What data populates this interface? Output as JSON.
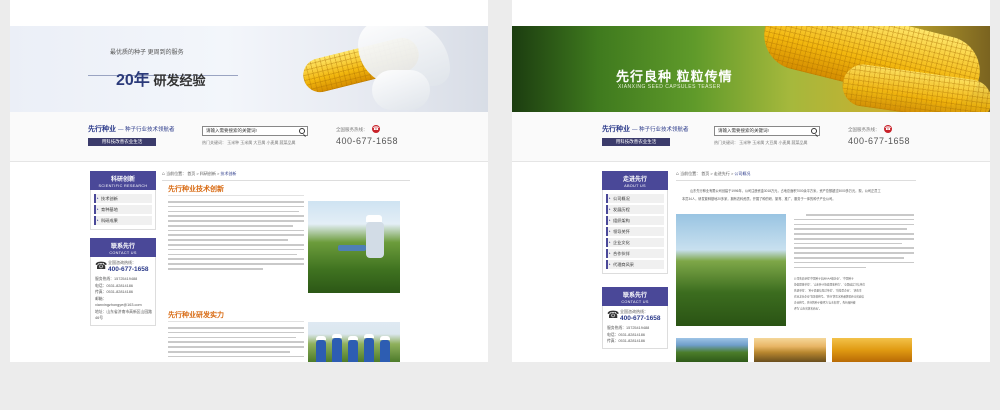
{
  "header": {
    "logo_brand": "先行种业",
    "logo_slogan": "— 种子行业技术领航者",
    "logo_tag": "用科技改善农业生活",
    "search_placeholder": "请输入需要搜索的关键词!",
    "hot_keywords": "热门关键词：  玉米种  玉米属  大豆属  小麦属  蔬菜品属",
    "hotline_label": "全国服务热线：",
    "hotline_number": "400-677-1658"
  },
  "left_page": {
    "banner": {
      "subtitle": "最优质的种子 更周到的服务",
      "years": "20年",
      "title": "研发经验"
    },
    "sidebar": {
      "title": "科研创新",
      "subtitle": "SCIENTIFIC RESEARCH",
      "items": [
        "技术创新",
        "育种基地",
        "科研成果"
      ]
    },
    "contact": {
      "title": "联系先行",
      "subtitle": "CONTACT US",
      "tel_label": "全国咨询热线：",
      "tel_number": "400-677-1658",
      "lines": [
        "服务热线：15725419488",
        "电话：0531-82814186",
        "传真：0531-82814186",
        "邮箱：",
        "xianxingzhongye@163.com",
        "地址：山东省济南市高新区山园路",
        "46号"
      ]
    },
    "breadcrumb": {
      "home": "当前位置：",
      "path": "首页  >  科研创新  >",
      "current": "技术创新"
    },
    "section1_title": "先行种业技术创新",
    "section2_title": "先行种业研发实力"
  },
  "right_page": {
    "banner": {
      "title": "先行良种  粒粒传情",
      "subtitle": "XIANXING SEED CAPSULES TEASER"
    },
    "sidebar": {
      "title": "走进先行",
      "subtitle": "ABOUT US",
      "items": [
        "公司概况",
        "发展历程",
        "组织架构",
        "领导关怀",
        "企业文化",
        "合作伙伴",
        "代理商风采"
      ]
    },
    "contact": {
      "title": "联系先行",
      "subtitle": "CONTACT US",
      "tel_label": "全国咨询热线：",
      "tel_number": "400-677-1658",
      "lines": [
        "服务热线：15725419488",
        "电话：0531-82814186",
        "传真：0531-82814186"
      ]
    },
    "breadcrumb": {
      "home": "当前位置：",
      "path": "首页  >  走进先行  >",
      "current": "公司概况"
    },
    "intro_lines": [
      "山东先行种业有限公司创建于1996年，公司注册资金3018万元，占地总面积7000余平方米，资产总额超过5000多万元，现，公司正员工",
      "本员34人，研发繁种基地20多家，拥有农科资质，开展了种的研、繁育、推广，服务于一体的种子产业公司。"
    ],
    "quote_lines": [
      "公司先后获得“中国种子信用AAA级企业”、“中国种子",
      "协会理事单位”、“山东种子协会理事单位”、“全国诚实守信单位",
      "先进单位”、“种子质量信得过单位”、“科技型企业”、“济南市",
      "农业龙头企业”等荣誉称号。“先行”牌玉米种品牌荣获全省诚信",
      "企业称号，先行牌种子被评为“山东名牌”，先行品种被",
      "评为“山东省著名商标”。"
    ]
  },
  "colors": {
    "accent_purple": "#4a4898",
    "title_orange": "#d86a12",
    "hotline_red": "#c8222a"
  }
}
